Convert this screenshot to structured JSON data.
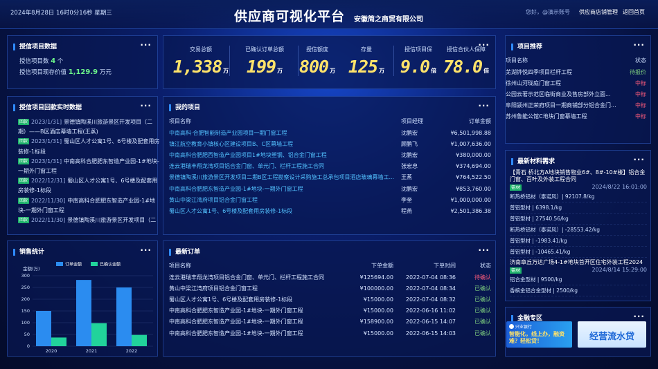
{
  "header": {
    "datetime": "2024年8月28日  16时0分16秒  星期三",
    "title": "供应商可视化平台",
    "company": "安徽简之商贸有限公司",
    "user": "您好，@演示账号",
    "manage_link": "供应商店铺管理",
    "home_link": "返回首页"
  },
  "credit_data": {
    "title": "授信项目数据",
    "count_label": "授信项目数",
    "count_value": "4",
    "count_unit": "个",
    "value_label": "授信项目现存价值",
    "value_value": "1,129.9",
    "value_unit": "万元"
  },
  "stats": [
    {
      "label": "交易总额",
      "value": "1,338",
      "unit": "万"
    },
    {
      "label": "已确认订单总额",
      "value": "199",
      "unit": "万"
    },
    {
      "label": "授信额度",
      "value": "800",
      "unit": "万"
    },
    {
      "label": "存量",
      "value": "125",
      "unit": "万"
    },
    {
      "label": "授信项目保",
      "value": "9.0",
      "unit": "倍"
    },
    {
      "label": "授信合伙人保障",
      "value": "78.0",
      "unit": "倍"
    }
  ],
  "realtime": {
    "title": "授信项目回款实时数据",
    "tag": "回款",
    "items": [
      {
        "date": "2023/1/31]",
        "text": "景德镇陶溪川旅游景区开发项目（二期）——B区酒店幕墙工程(王蒸)"
      },
      {
        "date": "2023/1/31]",
        "text": "蜀山区人才公寓1号、6号楼及配套用房装修-1标段"
      },
      {
        "date": "2023/1/31]",
        "text": "中南高科合肥肥东智造产业园-1#地块-一期外门窗工程"
      },
      {
        "date": "2022/12/31]",
        "text": "蜀山区人才公寓1号、6号楼及配套用房装修-1标段"
      },
      {
        "date": "2022/11/30]",
        "text": "中南高科合肥肥东智造产业园-1#地块-一期外门窗工程"
      },
      {
        "date": "2022/11/30]",
        "text": "景德镇陶溪川旅游景区开发项目（二"
      }
    ]
  },
  "my_projects": {
    "title": "我的项目",
    "headers": [
      "项目名称",
      "项目经理",
      "订单金额"
    ],
    "rows": [
      [
        "中南高科·合肥智能制造产业园项目一期门窗工程",
        "沈鹏宏",
        "¥6,501,998.88"
      ],
      [
        "镇江航空教育小镇核心区建设项目B、C区幕墙工程",
        "顾鹏飞",
        "¥1,007,636.00"
      ],
      [
        "中南高科合肥肥西智造产业园项目1#地块塑钢、铝合金门窗工程",
        "沈鹏宏",
        "¥380,000.00"
      ],
      [
        "连云港瑞丰翔龙湾项目铝合金门窗、单元门、栏杆工程施工合同",
        "张宏忠",
        "¥374,694.00"
      ],
      [
        "景德镇陶溪川旅游景区开发项目二期B区工程勘察设计采购施工总承包项目酒店玻璃幕墙工...",
        "王蒸",
        "¥764,522.50"
      ],
      [
        "中南高科合肥肥东智造产业园-1#地块-一期外门窗工程",
        "沈鹏宏",
        "¥853,760.00"
      ],
      [
        "黄山中梁江湾府项目铝合金门窗工程",
        "李奎",
        "¥1,000,000.00"
      ],
      [
        "蜀山区人才公寓1号、6号楼及配套用房装修-1标段",
        "程燕",
        "¥2,501,386.38"
      ]
    ]
  },
  "recommend": {
    "title": "项目推荐",
    "headers": [
      "项目名称",
      "状态"
    ],
    "rows": [
      [
        "芜湖铧悦四季项目栏杆工程",
        "待报价"
      ],
      [
        "徐州山河珑庭门窗工程",
        "中标"
      ],
      [
        "公园云著示范区临街商业及售房部外立面...",
        "中标"
      ],
      [
        "阜阳颍州正荣府项目一期商铺部分铝合金门...",
        "中标"
      ],
      [
        "苏州鲁能公馆C地块门窗幕墙工程",
        "中标"
      ]
    ]
  },
  "materials": {
    "title": "最新材料需求",
    "groups": [
      {
        "title": "【青石 桥北方A地块销售物业6#、8#-10#楼】铝合金门窗、百叶及外装工程合同",
        "tag": "铝材",
        "date": "2024/8/22 16:01:00",
        "lines": [
          "断热桥铝材（泰诺风）| 92107.8/kg",
          "普铝型材 | 6398.1/kg",
          "普铝型材 | 27540.56/kg",
          "断热桥铝材（泰诺风）| -28553.42/kg",
          "普铝型材 | -1983.41/kg",
          "普铝型材 | -10465.41/kg"
        ]
      },
      {
        "title": "济南章丘万达广场4-1#地块首开区住宅外装工程2024",
        "tag": "铝材",
        "date": "2024/8/14 15:29:00",
        "lines": [
          "铝合金型材 | 9500/kg",
          "香槟金铝合金型材 | 2500/kg"
        ]
      }
    ]
  },
  "sales": {
    "title": "销售统计",
    "legend_order": "订单金额",
    "legend_confirmed": "已确认金额",
    "ylabel": "金额(万)"
  },
  "chart_data": {
    "type": "bar",
    "categories": [
      "2020",
      "2021",
      "2022"
    ],
    "series": [
      {
        "name": "订单金额",
        "values": [
          150,
          282,
          250
        ]
      },
      {
        "name": "已确认金额",
        "values": [
          37,
          98,
          48
        ]
      }
    ],
    "ylabel": "金额(万)",
    "ylim": [
      0,
      300
    ],
    "yticks": [
      0,
      50,
      100,
      150,
      200,
      250,
      300
    ],
    "colors": [
      "#2b8cf0",
      "#21d39b"
    ],
    "grid": true,
    "legend": "top"
  },
  "orders": {
    "title": "最新订单",
    "headers": [
      "项目名称",
      "下单金额",
      "下单时间",
      "状态"
    ],
    "rows": [
      [
        "连云港瑞丰翔龙湾项目铝合金门窗、单元门、栏杆工程施工合同",
        "¥125694.00",
        "2022-07-04 08:36",
        "待确认"
      ],
      [
        "黄山中梁江湾府项目铝合金门窗工程",
        "¥100000.00",
        "2022-07-04 08:34",
        "已确认"
      ],
      [
        "蜀山区人才公寓1号、6号楼及配套用房装修-1标段",
        "¥15000.00",
        "2022-07-04 08:32",
        "已确认"
      ],
      [
        "中南高科合肥肥东智造产业园-1#地块-一期外门窗工程",
        "¥15000.00",
        "2022-06-16 11:02",
        "已确认"
      ],
      [
        "中南高科合肥肥东智造产业园-1#地块-一期外门窗工程",
        "¥158900.00",
        "2022-06-15 14:07",
        "已确认"
      ],
      [
        "中南高科合肥肥东智造产业园-1#地块-一期外门窗工程",
        "¥15000.00",
        "2022-06-15 14:03",
        "已确认"
      ]
    ]
  },
  "finance": {
    "title": "金融专区",
    "banner1_bank": "兴业银行",
    "banner1_text": "智能化，线上办，融资难？轻松贷！",
    "banner2_text": "经营流水贷"
  }
}
